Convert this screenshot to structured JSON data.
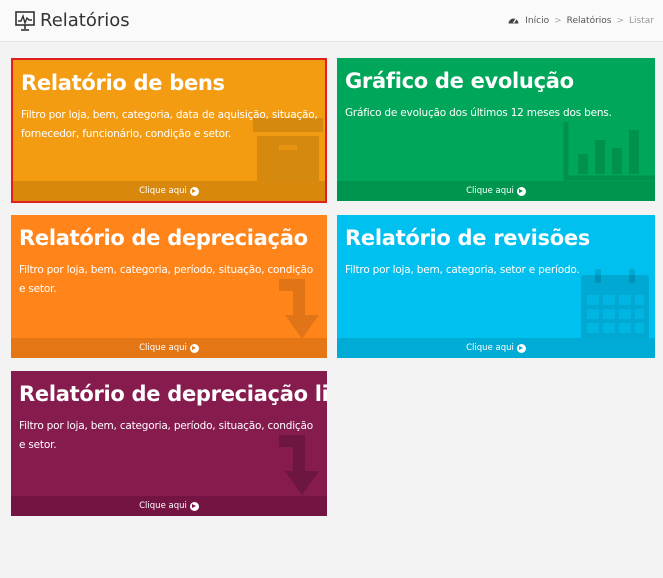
{
  "header": {
    "title": "Relatórios",
    "title_icon": "chart-board-icon",
    "breadcrumb": {
      "home_icon": "dashboard-icon",
      "items": [
        "Início",
        "Relatórios",
        "Listar"
      ],
      "separator": ">"
    }
  },
  "tiles": [
    {
      "title": "Relatório de bens",
      "description": "Filtro por loja, bem, categoria, data de aquisição, situação, fornecedor, funcionário, condição e setor.",
      "link_label": "Clique aqui",
      "icon": "archive-box-icon",
      "color": "#f39c12"
    },
    {
      "title": "Gráfico de evolução",
      "description": "Gráfico de evolução dos últimos 12 meses dos bens.",
      "link_label": "Clique aqui",
      "icon": "bar-chart-icon",
      "color": "#00a65a"
    },
    {
      "title": "Relatório de depreciação",
      "description": "Filtro por loja, bem, categoria, período, situação, condição e setor.",
      "link_label": "Clique aqui",
      "icon": "arrow-down-right-icon",
      "color": "#ff851b"
    },
    {
      "title": "Relatório de revisões",
      "description": "Filtro por loja, bem, categoria, setor e período.",
      "link_label": "Clique aqui",
      "icon": "calendar-icon",
      "color": "#00c0ef"
    },
    {
      "title": "Relatório de depreciação line",
      "description": "Filtro por loja, bem, categoria, período, situação, condição e setor.",
      "link_label": "Clique aqui",
      "icon": "arrow-down-right-icon",
      "color": "#861b4e"
    }
  ]
}
